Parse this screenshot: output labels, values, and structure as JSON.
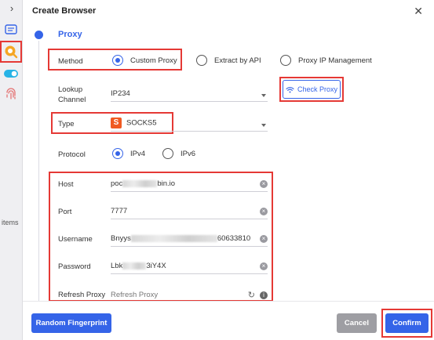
{
  "sidebar": {
    "items_label": "items"
  },
  "dialog": {
    "title": "Create Browser",
    "section": "Proxy",
    "method": {
      "label": "Method",
      "options": [
        "Custom Proxy",
        "Extract by API",
        "Proxy IP Management"
      ],
      "selected": "Custom Proxy"
    },
    "lookup_channel": {
      "label_line1": "Lookup",
      "label_line2": "Channel",
      "value": "IP234"
    },
    "check_proxy_label": "Check Proxy",
    "type": {
      "label": "Type",
      "badge": "S",
      "value": "SOCKS5"
    },
    "protocol": {
      "label": "Protocol",
      "options": [
        "IPv4",
        "IPv6"
      ],
      "selected": "IPv4"
    },
    "host": {
      "label": "Host",
      "value_start": "poc",
      "value_end": "bin.io"
    },
    "port": {
      "label": "Port",
      "value": "7777"
    },
    "username": {
      "label": "Username",
      "value_start": "Bnyys",
      "value_end": "60633810"
    },
    "password": {
      "label": "Password",
      "value_start": "Lbk",
      "value_end": "3iY4X"
    },
    "refresh_proxy": {
      "label": "Refresh Proxy",
      "placeholder": "Refresh Proxy"
    }
  },
  "footer": {
    "random_fingerprint": "Random Fingerprint",
    "cancel": "Cancel",
    "confirm": "Confirm"
  },
  "colors": {
    "accent": "#3564e8",
    "highlight": "#e53935",
    "cancel": "#9e9ea3"
  }
}
